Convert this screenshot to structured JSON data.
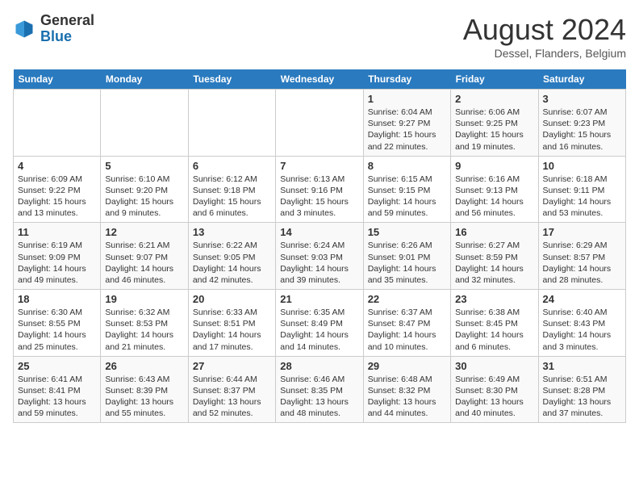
{
  "header": {
    "logo_general": "General",
    "logo_blue": "Blue",
    "month_title": "August 2024",
    "subtitle": "Dessel, Flanders, Belgium"
  },
  "days_of_week": [
    "Sunday",
    "Monday",
    "Tuesday",
    "Wednesday",
    "Thursday",
    "Friday",
    "Saturday"
  ],
  "weeks": [
    [
      {
        "num": "",
        "info": ""
      },
      {
        "num": "",
        "info": ""
      },
      {
        "num": "",
        "info": ""
      },
      {
        "num": "",
        "info": ""
      },
      {
        "num": "1",
        "info": "Sunrise: 6:04 AM\nSunset: 9:27 PM\nDaylight: 15 hours and 22 minutes."
      },
      {
        "num": "2",
        "info": "Sunrise: 6:06 AM\nSunset: 9:25 PM\nDaylight: 15 hours and 19 minutes."
      },
      {
        "num": "3",
        "info": "Sunrise: 6:07 AM\nSunset: 9:23 PM\nDaylight: 15 hours and 16 minutes."
      }
    ],
    [
      {
        "num": "4",
        "info": "Sunrise: 6:09 AM\nSunset: 9:22 PM\nDaylight: 15 hours and 13 minutes."
      },
      {
        "num": "5",
        "info": "Sunrise: 6:10 AM\nSunset: 9:20 PM\nDaylight: 15 hours and 9 minutes."
      },
      {
        "num": "6",
        "info": "Sunrise: 6:12 AM\nSunset: 9:18 PM\nDaylight: 15 hours and 6 minutes."
      },
      {
        "num": "7",
        "info": "Sunrise: 6:13 AM\nSunset: 9:16 PM\nDaylight: 15 hours and 3 minutes."
      },
      {
        "num": "8",
        "info": "Sunrise: 6:15 AM\nSunset: 9:15 PM\nDaylight: 14 hours and 59 minutes."
      },
      {
        "num": "9",
        "info": "Sunrise: 6:16 AM\nSunset: 9:13 PM\nDaylight: 14 hours and 56 minutes."
      },
      {
        "num": "10",
        "info": "Sunrise: 6:18 AM\nSunset: 9:11 PM\nDaylight: 14 hours and 53 minutes."
      }
    ],
    [
      {
        "num": "11",
        "info": "Sunrise: 6:19 AM\nSunset: 9:09 PM\nDaylight: 14 hours and 49 minutes."
      },
      {
        "num": "12",
        "info": "Sunrise: 6:21 AM\nSunset: 9:07 PM\nDaylight: 14 hours and 46 minutes."
      },
      {
        "num": "13",
        "info": "Sunrise: 6:22 AM\nSunset: 9:05 PM\nDaylight: 14 hours and 42 minutes."
      },
      {
        "num": "14",
        "info": "Sunrise: 6:24 AM\nSunset: 9:03 PM\nDaylight: 14 hours and 39 minutes."
      },
      {
        "num": "15",
        "info": "Sunrise: 6:26 AM\nSunset: 9:01 PM\nDaylight: 14 hours and 35 minutes."
      },
      {
        "num": "16",
        "info": "Sunrise: 6:27 AM\nSunset: 8:59 PM\nDaylight: 14 hours and 32 minutes."
      },
      {
        "num": "17",
        "info": "Sunrise: 6:29 AM\nSunset: 8:57 PM\nDaylight: 14 hours and 28 minutes."
      }
    ],
    [
      {
        "num": "18",
        "info": "Sunrise: 6:30 AM\nSunset: 8:55 PM\nDaylight: 14 hours and 25 minutes."
      },
      {
        "num": "19",
        "info": "Sunrise: 6:32 AM\nSunset: 8:53 PM\nDaylight: 14 hours and 21 minutes."
      },
      {
        "num": "20",
        "info": "Sunrise: 6:33 AM\nSunset: 8:51 PM\nDaylight: 14 hours and 17 minutes."
      },
      {
        "num": "21",
        "info": "Sunrise: 6:35 AM\nSunset: 8:49 PM\nDaylight: 14 hours and 14 minutes."
      },
      {
        "num": "22",
        "info": "Sunrise: 6:37 AM\nSunset: 8:47 PM\nDaylight: 14 hours and 10 minutes."
      },
      {
        "num": "23",
        "info": "Sunrise: 6:38 AM\nSunset: 8:45 PM\nDaylight: 14 hours and 6 minutes."
      },
      {
        "num": "24",
        "info": "Sunrise: 6:40 AM\nSunset: 8:43 PM\nDaylight: 14 hours and 3 minutes."
      }
    ],
    [
      {
        "num": "25",
        "info": "Sunrise: 6:41 AM\nSunset: 8:41 PM\nDaylight: 13 hours and 59 minutes."
      },
      {
        "num": "26",
        "info": "Sunrise: 6:43 AM\nSunset: 8:39 PM\nDaylight: 13 hours and 55 minutes."
      },
      {
        "num": "27",
        "info": "Sunrise: 6:44 AM\nSunset: 8:37 PM\nDaylight: 13 hours and 52 minutes."
      },
      {
        "num": "28",
        "info": "Sunrise: 6:46 AM\nSunset: 8:35 PM\nDaylight: 13 hours and 48 minutes."
      },
      {
        "num": "29",
        "info": "Sunrise: 6:48 AM\nSunset: 8:32 PM\nDaylight: 13 hours and 44 minutes."
      },
      {
        "num": "30",
        "info": "Sunrise: 6:49 AM\nSunset: 8:30 PM\nDaylight: 13 hours and 40 minutes."
      },
      {
        "num": "31",
        "info": "Sunrise: 6:51 AM\nSunset: 8:28 PM\nDaylight: 13 hours and 37 minutes."
      }
    ]
  ]
}
